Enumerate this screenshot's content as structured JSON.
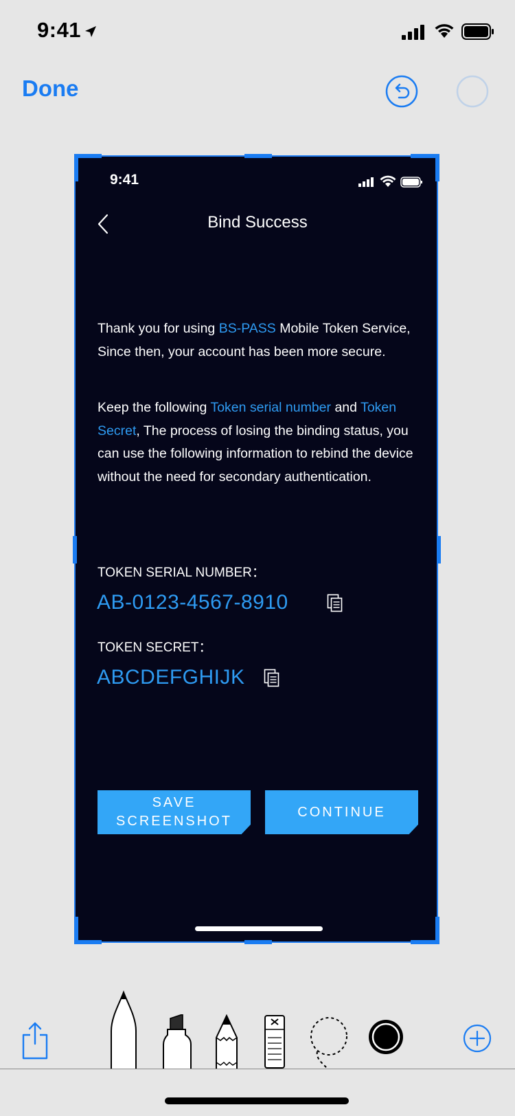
{
  "status_bar": {
    "time": "9:41"
  },
  "markup_toolbar": {
    "done_label": "Done",
    "undo_icon": "undo-icon",
    "accent_color": "#1a7cf2"
  },
  "screenshot": {
    "status_time": "9:41",
    "nav": {
      "title": "Bind Success"
    },
    "paragraph1": {
      "pre": "Thank you for using ",
      "highlight": "BS-PASS",
      "post": " Mobile Token Service, Since then, your account has been more secure."
    },
    "paragraph2": {
      "pre": "Keep the following ",
      "highlight1": "Token serial number",
      "mid": " and ",
      "highlight2": "Token Secret",
      "post": ", The process of losing the binding status, you can use the following information to rebind the device without the need for secondary authentication."
    },
    "serial": {
      "label": "TOKEN SERIAL NUMBER：",
      "value": "AB-0123-4567-8910"
    },
    "secret": {
      "label": "TOKEN SECRET：",
      "value": "ABCDEFGHIJK"
    },
    "buttons": {
      "save_line1": "SAVE",
      "save_line2": "SCREENSHOT",
      "continue": "CONTINUE"
    },
    "colors": {
      "background": "#05061a",
      "highlight": "#2e9bf2",
      "button": "#33a6f7"
    }
  },
  "tools": [
    "share-icon",
    "pen-icon",
    "marker-icon",
    "pencil-icon",
    "eraser-icon",
    "lasso-icon",
    "color-picker-icon",
    "add-icon"
  ]
}
